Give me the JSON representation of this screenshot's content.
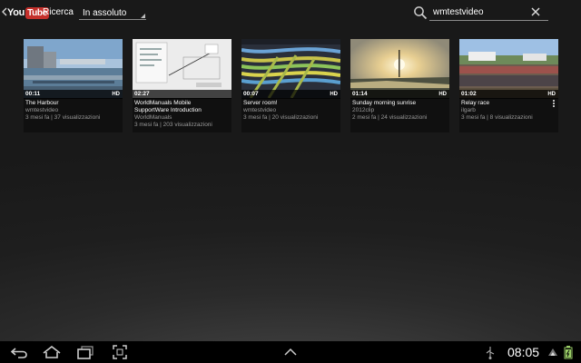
{
  "app": {
    "logo_you": "You",
    "logo_tube": "Tube",
    "section_title": "Ricerca",
    "filter_label": "In assoluto",
    "search_query": "wmtestvideo"
  },
  "videos": [
    {
      "duration": "00:11",
      "hd": "HD",
      "title": "The Harbour",
      "channel": "wmtestvideo",
      "stats": "3 mesi fa | 37 visualizzazioni"
    },
    {
      "duration": "02:27",
      "hd": "",
      "title": "WorldManuals Mobile SupportWare Introduction",
      "channel": "WorldManuals",
      "stats": "3 mesi fa | 203 visualizzazioni"
    },
    {
      "duration": "00:07",
      "hd": "HD",
      "title": "Server room!",
      "channel": "wmtestvideo",
      "stats": "3 mesi fa | 20 visualizzazioni"
    },
    {
      "duration": "01:14",
      "hd": "HD",
      "title": "Sunday morning sunrise",
      "channel": "2012clip",
      "stats": "2 mesi fa | 24 visualizzazioni"
    },
    {
      "duration": "01:02",
      "hd": "HD",
      "title": "Relay race",
      "channel": "ilgarb",
      "stats": "3 mesi fa | 8 visualizzazioni"
    }
  ],
  "icons": {
    "back": "chevron-left-icon",
    "search": "search-icon",
    "clear": "close-icon",
    "more": "overflow-menu-icon"
  },
  "system_bar": {
    "clock": "08:05",
    "icons": [
      "back-icon",
      "home-icon",
      "recent-apps-icon",
      "screenshot-icon",
      "expand-up-icon",
      "usb-icon",
      "wifi-icon",
      "battery-icon"
    ]
  },
  "colors": {
    "youtube_red": "#c4302b",
    "background": "#1e1e1e",
    "card": "#101010",
    "secondary_text": "#9a9a9a"
  }
}
